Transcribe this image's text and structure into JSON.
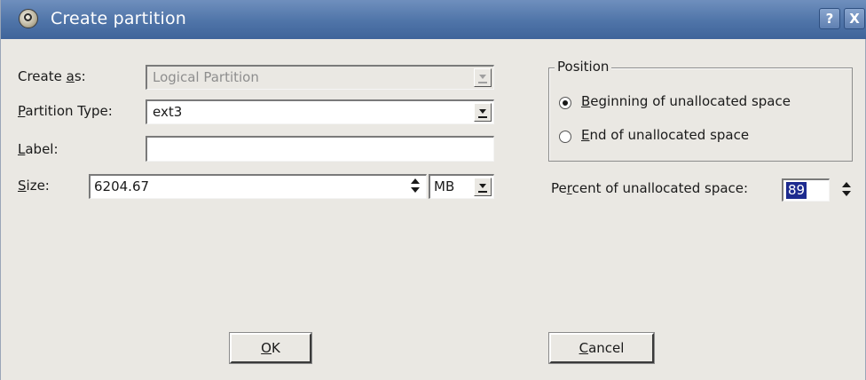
{
  "window": {
    "title": "Create partition",
    "help_label": "?",
    "close_label": "X",
    "icon": "app-icon"
  },
  "form": {
    "create_as": {
      "label_pre": "Create ",
      "label_key": "a",
      "label_post": "s:",
      "value": "Logical Partition",
      "disabled": true
    },
    "partition_type": {
      "label_key": "P",
      "label_post": "artition Type:",
      "value": "ext3"
    },
    "label": {
      "label_key": "L",
      "label_post": "abel:",
      "value": ""
    },
    "size": {
      "label_key": "S",
      "label_post": "ize:",
      "value": "6204.67",
      "unit": "MB"
    }
  },
  "position": {
    "title": "Position",
    "options": [
      {
        "key": "B",
        "rest": "eginning of unallocated space",
        "checked": true
      },
      {
        "key": "E",
        "rest": "nd of unallocated space",
        "checked": false
      }
    ]
  },
  "percent": {
    "label_pre": "Pe",
    "label_key": "r",
    "label_post": "cent of unallocated space:",
    "value": "89"
  },
  "buttons": {
    "ok": {
      "key": "O",
      "rest": "K"
    },
    "cancel": {
      "key": "C",
      "rest": "ancel"
    }
  }
}
